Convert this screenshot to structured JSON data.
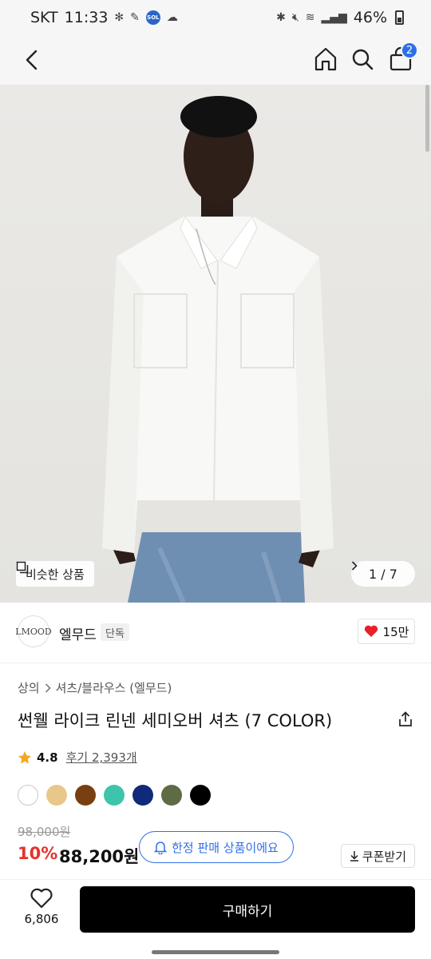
{
  "status_bar": {
    "carrier": "SKT",
    "time": "11:33",
    "battery": "46%"
  },
  "nav": {
    "cart_count": "2"
  },
  "gallery": {
    "similar_label": "비슷한 상품",
    "page_indicator": "1 / 7"
  },
  "brand": {
    "logo_text": "LMOOD",
    "name": "엘무드",
    "tag": "단독",
    "likes": "15만"
  },
  "product": {
    "breadcrumb": [
      "상의",
      "셔츠/블라우스 (엘무드)"
    ],
    "title": "썬웰 라이크 린넨 세미오버 셔츠 (7 COLOR)",
    "rating": "4.8",
    "reviews": "후기 2,393개",
    "colors": [
      "#ffffff",
      "#e8c88a",
      "#7a3f10",
      "#3ec4aa",
      "#0f2a7a",
      "#5e6b45",
      "#000000"
    ],
    "original_price": "98,000원",
    "discount": "10%",
    "price": "88,200원",
    "limited_label": "한정 판매 상품이에요",
    "coupon_label": "쿠폰받기"
  },
  "bottom_bar": {
    "wish_count": "6,806",
    "buy_label": "구매하기"
  },
  "theme": {
    "accent": "#2f6fe6",
    "sale": "#e6322e",
    "star": "#f5a623",
    "heart": "#e8202a"
  }
}
